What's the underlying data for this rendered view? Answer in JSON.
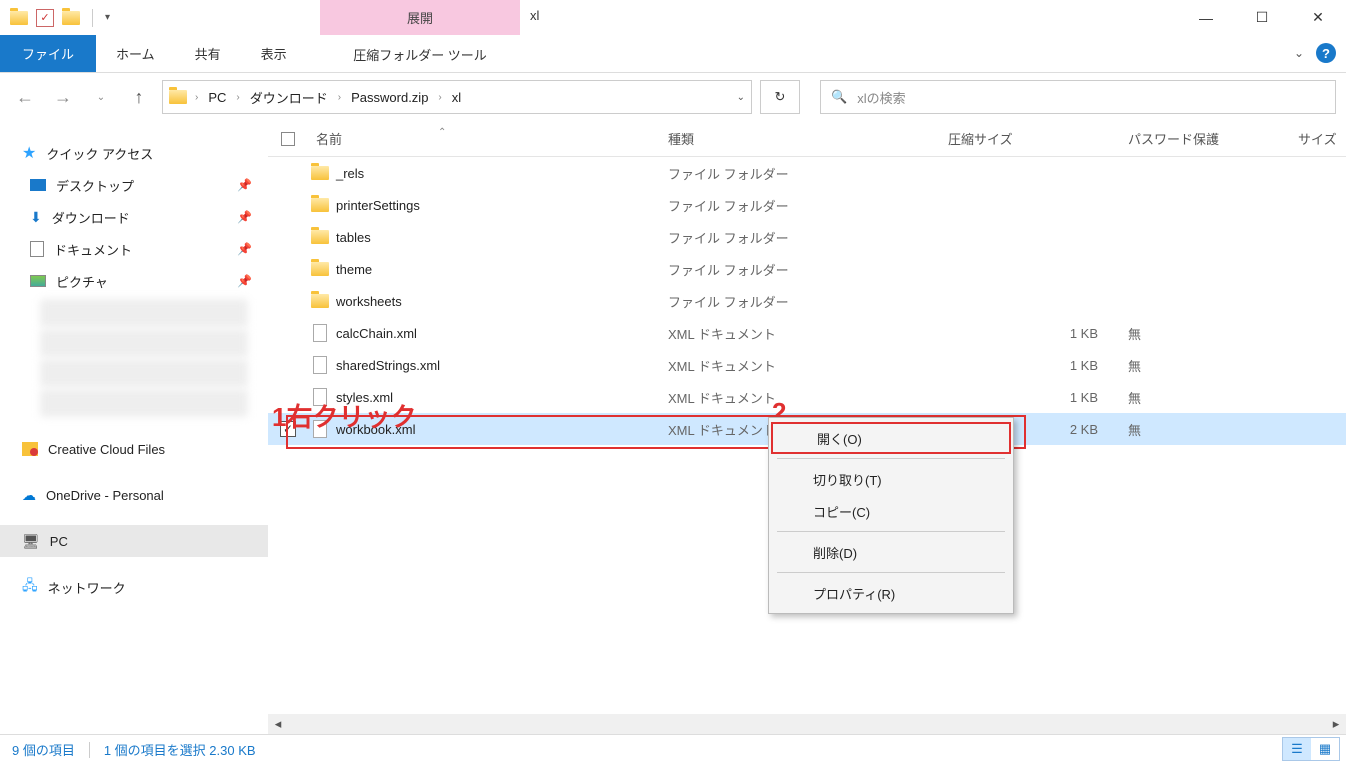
{
  "window": {
    "title": "xl",
    "contextual_upper": "展開",
    "contextual_lower": "圧縮フォルダー ツール"
  },
  "tabs": {
    "file": "ファイル",
    "home": "ホーム",
    "share": "共有",
    "view": "表示"
  },
  "breadcrumbs": [
    "PC",
    "ダウンロード",
    "Password.zip",
    "xl"
  ],
  "search": {
    "placeholder": "xlの検索"
  },
  "sidebar": {
    "quick_access": "クイック アクセス",
    "desktop": "デスクトップ",
    "downloads": "ダウンロード",
    "documents": "ドキュメント",
    "pictures": "ピクチャ",
    "creative_cloud": "Creative Cloud Files",
    "onedrive": "OneDrive - Personal",
    "pc": "PC",
    "network": "ネットワーク"
  },
  "columns": {
    "name": "名前",
    "type": "種類",
    "size": "圧縮サイズ",
    "pwd": "パスワード保護",
    "sz2": "サイズ"
  },
  "files": [
    {
      "name": "_rels",
      "type": "ファイル フォルダー",
      "size": "",
      "pwd": "",
      "kind": "folder"
    },
    {
      "name": "printerSettings",
      "type": "ファイル フォルダー",
      "size": "",
      "pwd": "",
      "kind": "folder"
    },
    {
      "name": "tables",
      "type": "ファイル フォルダー",
      "size": "",
      "pwd": "",
      "kind": "folder"
    },
    {
      "name": "theme",
      "type": "ファイル フォルダー",
      "size": "",
      "pwd": "",
      "kind": "folder"
    },
    {
      "name": "worksheets",
      "type": "ファイル フォルダー",
      "size": "",
      "pwd": "",
      "kind": "folder"
    },
    {
      "name": "calcChain.xml",
      "type": "XML ドキュメント",
      "size": "1 KB",
      "pwd": "無",
      "kind": "file"
    },
    {
      "name": "sharedStrings.xml",
      "type": "XML ドキュメント",
      "size": "1 KB",
      "pwd": "無",
      "kind": "file"
    },
    {
      "name": "styles.xml",
      "type": "XML ドキュメント",
      "size": "1 KB",
      "pwd": "無",
      "kind": "file"
    },
    {
      "name": "workbook.xml",
      "type": "XML ドキュメント",
      "size": "2 KB",
      "pwd": "無",
      "kind": "file",
      "selected": true
    }
  ],
  "annotations": {
    "label1": "1右クリック",
    "label2": "2"
  },
  "context_menu": {
    "open": "開く(O)",
    "cut": "切り取り(T)",
    "copy": "コピー(C)",
    "delete": "削除(D)",
    "properties": "プロパティ(R)"
  },
  "statusbar": {
    "count": "9 個の項目",
    "selection": "1 個の項目を選択 2.30 KB"
  }
}
